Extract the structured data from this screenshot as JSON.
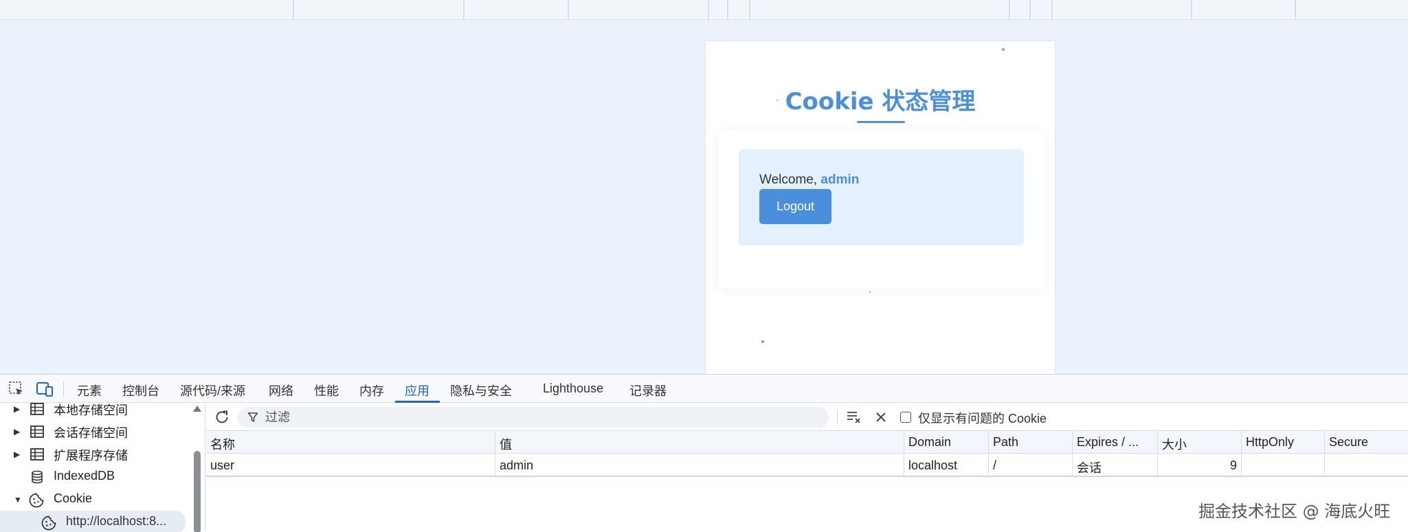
{
  "page": {
    "title": "Cookie 状态管理",
    "welcome_prefix": "Welcome, ",
    "username": "admin",
    "logout_label": "Logout"
  },
  "devtools": {
    "tabs": [
      {
        "label": "元素",
        "active": false
      },
      {
        "label": "控制台",
        "active": false
      },
      {
        "label": "源代码/来源",
        "active": false
      },
      {
        "label": "网络",
        "active": false
      },
      {
        "label": "性能",
        "active": false
      },
      {
        "label": "内存",
        "active": false
      },
      {
        "label": "应用",
        "active": true
      },
      {
        "label": "隐私与安全",
        "active": false
      },
      {
        "label": "Lighthouse",
        "active": false
      },
      {
        "label": "记录器",
        "active": false
      }
    ],
    "sidebar": {
      "items": [
        {
          "label": "本地存储空间",
          "icon": "table-icon",
          "expandable": true
        },
        {
          "label": "会话存储空间",
          "icon": "table-icon",
          "expandable": true
        },
        {
          "label": "扩展程序存储",
          "icon": "table-icon",
          "expandable": true
        },
        {
          "label": "IndexedDB",
          "icon": "database-icon",
          "expandable": false
        },
        {
          "label": "Cookie",
          "icon": "cookie-icon",
          "expandable": true,
          "expanded": true
        },
        {
          "label": "http://localhost:8...",
          "icon": "cookie-icon",
          "selected": true
        }
      ]
    },
    "cookies": {
      "filter_placeholder": "过滤",
      "only_issues_label": "仅显示有问题的 Cookie",
      "only_issues_checked": false,
      "columns": [
        "名称",
        "值",
        "Domain",
        "Path",
        "Expires / ...",
        "大小",
        "HttpOnly",
        "Secure"
      ],
      "rows": [
        {
          "name": "user",
          "value": "admin",
          "domain": "localhost",
          "path": "/",
          "expires": "会话",
          "size": "9",
          "httponly": "",
          "secure": ""
        }
      ]
    }
  },
  "watermark": "掘金技术社区 @ 海底火旺",
  "colors": {
    "accent": "#4a8fdc",
    "devtools_active": "#1a66c9",
    "welcome_bg": "#e3f0fd"
  }
}
